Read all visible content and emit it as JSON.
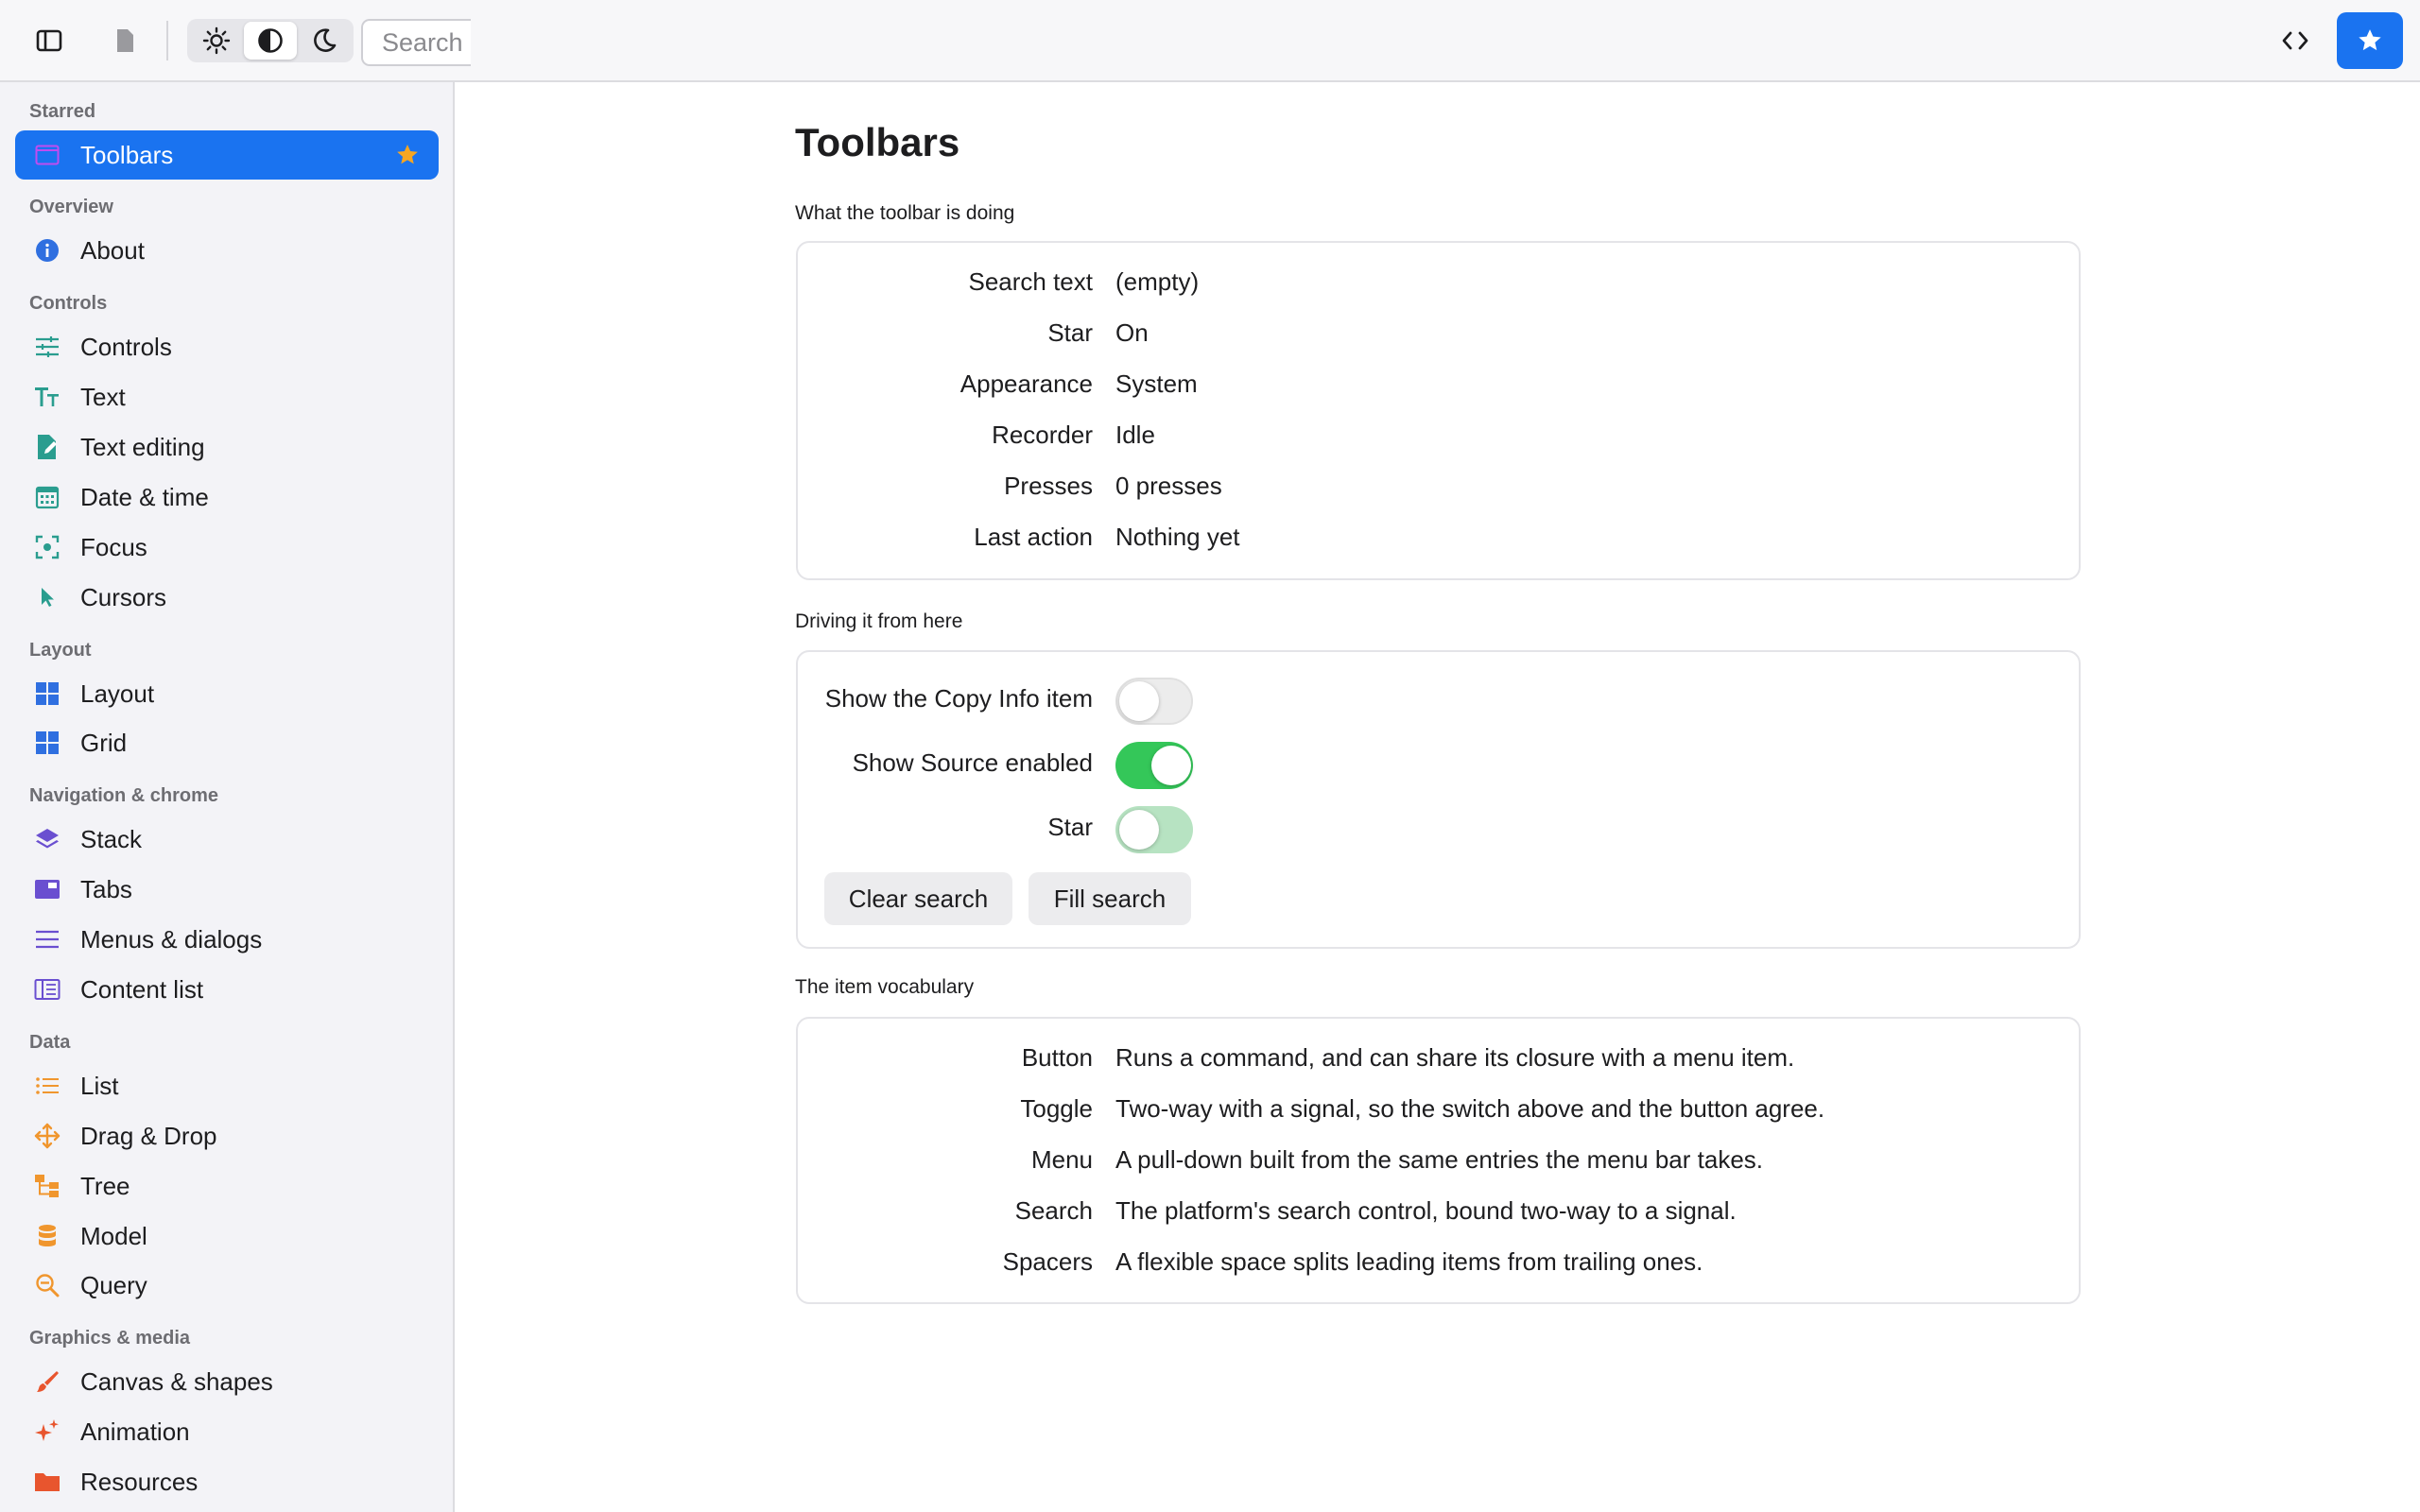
{
  "toolbar": {
    "search_placeholder": "Search",
    "appearance_options": [
      "light",
      "system",
      "dark"
    ],
    "appearance_selected": "system",
    "accent": "#1a73f0"
  },
  "sidebar": {
    "sections": [
      {
        "title": "Starred",
        "items": [
          {
            "label": "Toolbars",
            "icon": "window-icon",
            "starred": true,
            "selected": true
          }
        ]
      },
      {
        "title": "Overview",
        "items": [
          {
            "label": "About",
            "icon": "info-circle-icon"
          }
        ]
      },
      {
        "title": "Controls",
        "items": [
          {
            "label": "Controls",
            "icon": "sliders-icon"
          },
          {
            "label": "Text",
            "icon": "text-size-icon"
          },
          {
            "label": "Text editing",
            "icon": "doc-edit-icon"
          },
          {
            "label": "Date & time",
            "icon": "calendar-icon"
          },
          {
            "label": "Focus",
            "icon": "focus-icon"
          },
          {
            "label": "Cursors",
            "icon": "cursor-icon"
          }
        ]
      },
      {
        "title": "Layout",
        "items": [
          {
            "label": "Layout",
            "icon": "layout-grid-icon"
          },
          {
            "label": "Grid",
            "icon": "grid-icon"
          }
        ]
      },
      {
        "title": "Navigation & chrome",
        "items": [
          {
            "label": "Stack",
            "icon": "stack-icon"
          },
          {
            "label": "Tabs",
            "icon": "tabs-icon"
          },
          {
            "label": "Menus & dialogs",
            "icon": "menu-lines-icon"
          },
          {
            "label": "Content list",
            "icon": "content-list-icon"
          }
        ]
      },
      {
        "title": "Data",
        "items": [
          {
            "label": "List",
            "icon": "list-icon"
          },
          {
            "label": "Drag & Drop",
            "icon": "move-icon"
          },
          {
            "label": "Tree",
            "icon": "tree-icon"
          },
          {
            "label": "Model",
            "icon": "database-icon"
          },
          {
            "label": "Query",
            "icon": "magnifier-icon"
          }
        ]
      },
      {
        "title": "Graphics & media",
        "items": [
          {
            "label": "Canvas & shapes",
            "icon": "brush-icon"
          },
          {
            "label": "Animation",
            "icon": "sparkle-icon"
          },
          {
            "label": "Resources",
            "icon": "folder-icon"
          }
        ]
      }
    ]
  },
  "main": {
    "title": "Toolbars",
    "status": {
      "label": "What the toolbar is doing",
      "rows": [
        {
          "key": "Search text",
          "value": "(empty)"
        },
        {
          "key": "Star",
          "value": "On"
        },
        {
          "key": "Appearance",
          "value": "System"
        },
        {
          "key": "Recorder",
          "value": "Idle"
        },
        {
          "key": "Presses",
          "value": "0 presses"
        },
        {
          "key": "Last action",
          "value": "Nothing yet"
        }
      ]
    },
    "driving": {
      "label": "Driving it from here",
      "toggles": [
        {
          "label": "Show the Copy Info item",
          "on": false
        },
        {
          "label": "Show Source enabled",
          "on": true
        },
        {
          "label": "Star",
          "on": true
        }
      ],
      "buttons": [
        "Clear search",
        "Fill search"
      ]
    },
    "vocab": {
      "label": "The item vocabulary",
      "rows": [
        {
          "key": "Button",
          "value": "Runs a command, and can share its closure with a menu item."
        },
        {
          "key": "Toggle",
          "value": "Two-way with a signal, so the switch above and the button agree."
        },
        {
          "key": "Menu",
          "value": "A pull-down built from the same entries the menu bar takes."
        },
        {
          "key": "Search",
          "value": "The platform's search control, bound two-way to a signal."
        },
        {
          "key": "Spacers",
          "value": "A flexible space splits leading items from trailing ones."
        }
      ]
    }
  }
}
